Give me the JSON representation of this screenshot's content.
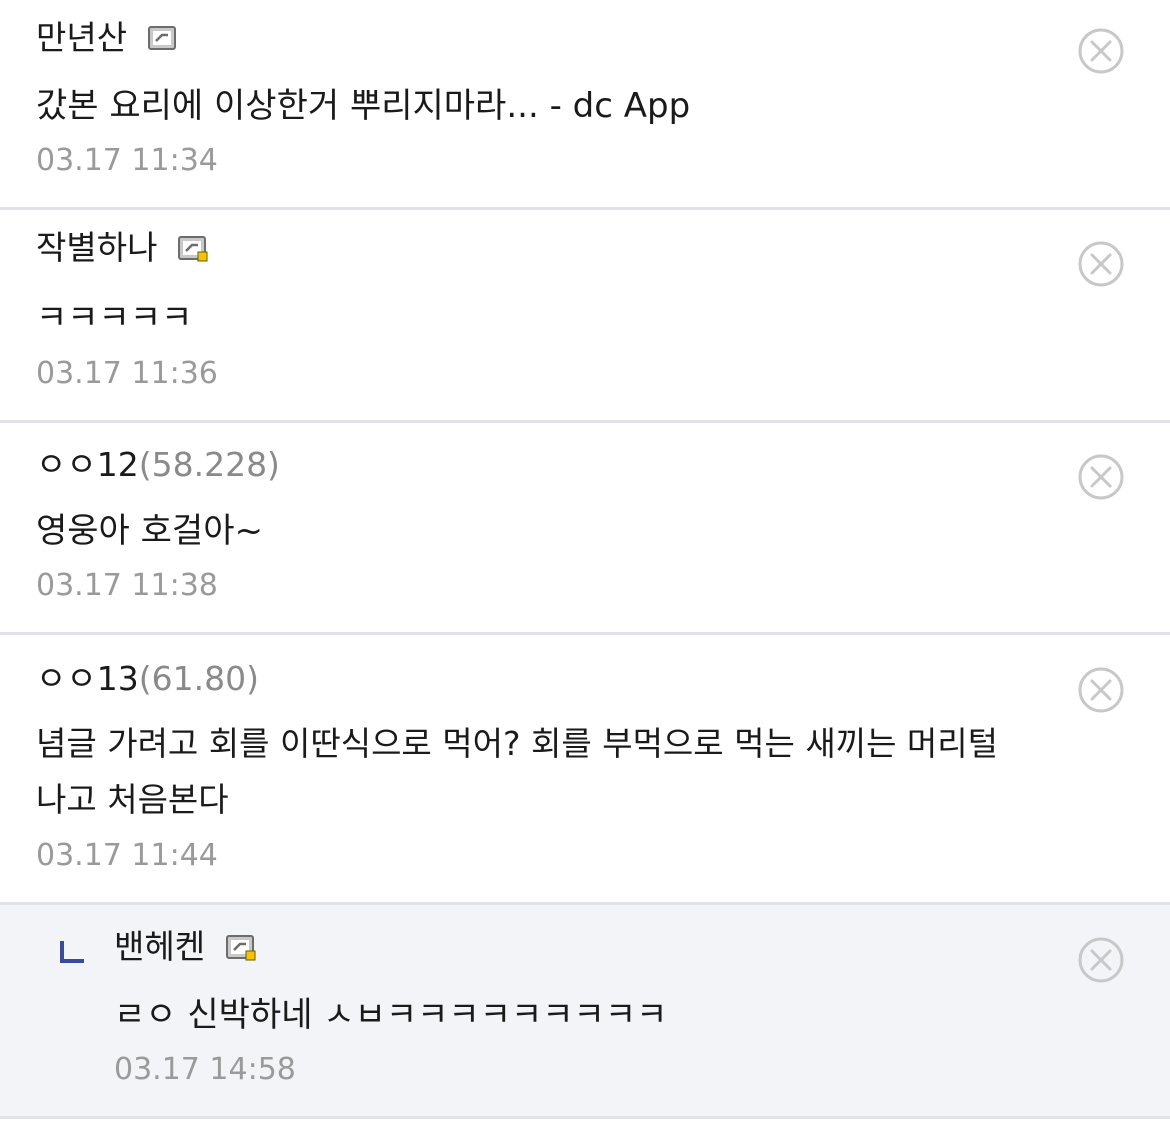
{
  "comments": [
    {
      "author": "만년산",
      "author_ip": "",
      "badge_icon": "gallog-fixed-icon",
      "text": "갔본 요리에 이상한거 뿌리지마라... - dc App",
      "time": "03.17 11:34"
    },
    {
      "author": "작별하나",
      "author_ip": "",
      "badge_icon": "gallog-semi-fixed-icon",
      "text": "ㅋㅋㅋㅋㅋ",
      "time": "03.17 11:36"
    },
    {
      "author": "ㅇㅇ12",
      "author_ip": "(58.228)",
      "badge_icon": "",
      "text": "영웅아 호걸아~",
      "time": "03.17 11:38"
    },
    {
      "author": "ㅇㅇ13",
      "author_ip": "(61.80)",
      "badge_icon": "",
      "text_line1": "념글 가려고 회를 이딴식으로 먹어? 회를 부먹으로 먹는 새끼는 머리털",
      "text_line2": "나고 처음본다",
      "time": "03.17 11:44"
    }
  ],
  "reply": {
    "reply_marker_icon": "reply-arrow-icon",
    "author": "밴헤켄",
    "badge_icon": "gallog-semi-fixed-icon",
    "text": "ㄹㅇ 신박하네 ㅅㅂㅋㅋㅋㅋㅋㅋㅋㅋㅋ",
    "time": "03.17 14:58"
  },
  "delete_icon": "close-circle-icon",
  "colors": {
    "separator": "#e1e1ea",
    "reply_background": "#f3f4f8",
    "timestamp": "#9a9a9a",
    "reply_marker": "#3b4a9a",
    "semi_fixed_badge_dot": "#f3c400"
  }
}
